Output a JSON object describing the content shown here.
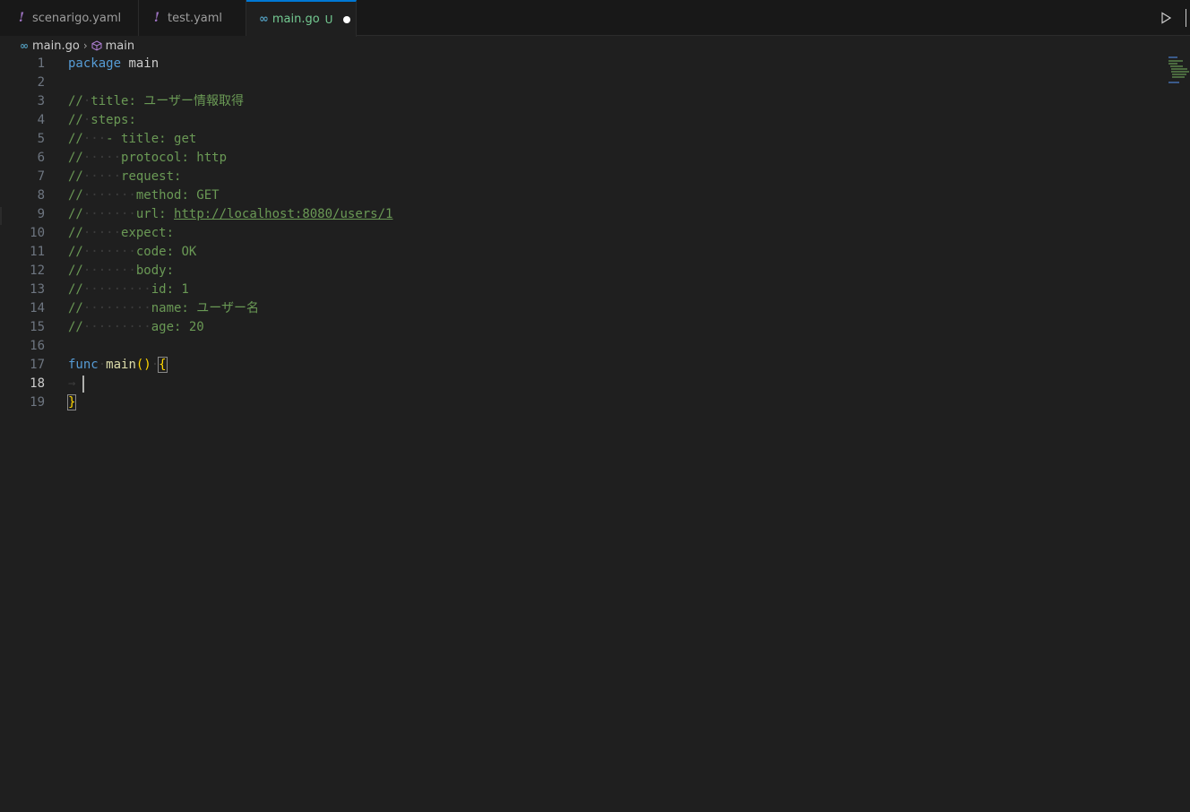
{
  "tabs": [
    {
      "label": "scenarigo.yaml",
      "icon": "yaml-exclamation-icon",
      "active": false
    },
    {
      "label": "test.yaml",
      "icon": "yaml-exclamation-icon",
      "active": false
    },
    {
      "label": "main.go",
      "icon": "go-icon",
      "status": "U",
      "active": true,
      "dirty": true
    }
  ],
  "breadcrumb": {
    "file": "main.go",
    "symbol": "main"
  },
  "editor": {
    "current_line": 18,
    "lines": [
      {
        "n": "1",
        "kind": "package",
        "kw": "package",
        "rest": " main"
      },
      {
        "n": "2",
        "kind": "empty"
      },
      {
        "n": "3",
        "kind": "comment",
        "prefix": "//",
        "text": "title: ユーザー情報取得"
      },
      {
        "n": "4",
        "kind": "comment",
        "prefix": "//",
        "text": "steps:"
      },
      {
        "n": "5",
        "kind": "comment",
        "prefix": "//",
        "text": "- title: get"
      },
      {
        "n": "6",
        "kind": "comment",
        "prefix": "//",
        "text": "protocol: http"
      },
      {
        "n": "7",
        "kind": "comment",
        "prefix": "//",
        "text": "request:"
      },
      {
        "n": "8",
        "kind": "comment",
        "prefix": "//",
        "text": "method: GET"
      },
      {
        "n": "9",
        "kind": "comment-url",
        "prefix": "//",
        "text": "url: ",
        "url": "http://localhost:8080/users/1"
      },
      {
        "n": "10",
        "kind": "comment",
        "prefix": "//",
        "text": "expect:"
      },
      {
        "n": "11",
        "kind": "comment",
        "prefix": "//",
        "text": "code: OK"
      },
      {
        "n": "12",
        "kind": "comment",
        "prefix": "//",
        "text": "body:"
      },
      {
        "n": "13",
        "kind": "comment",
        "prefix": "//",
        "text": "id: 1"
      },
      {
        "n": "14",
        "kind": "comment",
        "prefix": "//",
        "text": "name: ユーザー名"
      },
      {
        "n": "15",
        "kind": "comment",
        "prefix": "//",
        "text": "age: 20"
      },
      {
        "n": "16",
        "kind": "empty"
      },
      {
        "n": "17",
        "kind": "func",
        "kw": "func",
        "fn": "main",
        "parens": "()",
        "brace": "{"
      },
      {
        "n": "18",
        "kind": "cursor"
      },
      {
        "n": "19",
        "kind": "close",
        "brace": "}"
      }
    ]
  },
  "colors": {
    "background": "#1f1f1f",
    "keyword": "#569cd6",
    "comment": "#6a9955",
    "function": "#dcdcaa",
    "bracket": "#ffd700",
    "active_tab_border": "#0078d4",
    "git_untracked": "#73c991"
  }
}
